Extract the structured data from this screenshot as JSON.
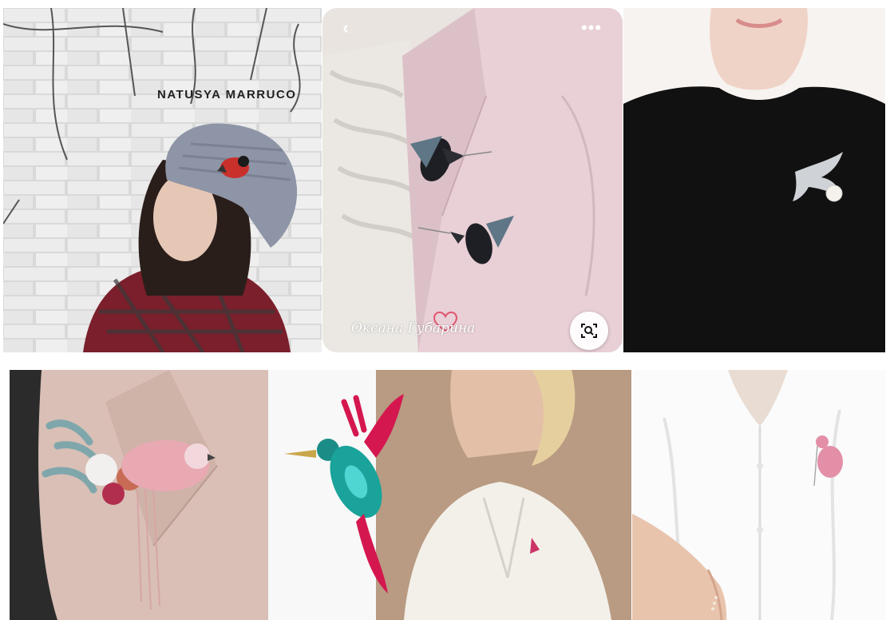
{
  "gallery": {
    "pins": [
      {
        "watermark": "NATUSYA MARRUCO"
      },
      {
        "signature": "Оксана Губарина",
        "back_icon": "chevron-left-icon",
        "more_icon": "more-horizontal-icon",
        "lens_icon": "visual-search-icon"
      },
      {},
      {},
      {},
      {}
    ]
  },
  "colors": {
    "overlay_button_bg": "#ffffff",
    "blazer_pink": "#e8d0d6",
    "black_top": "#111111",
    "hat_gray": "#8e95a6"
  }
}
